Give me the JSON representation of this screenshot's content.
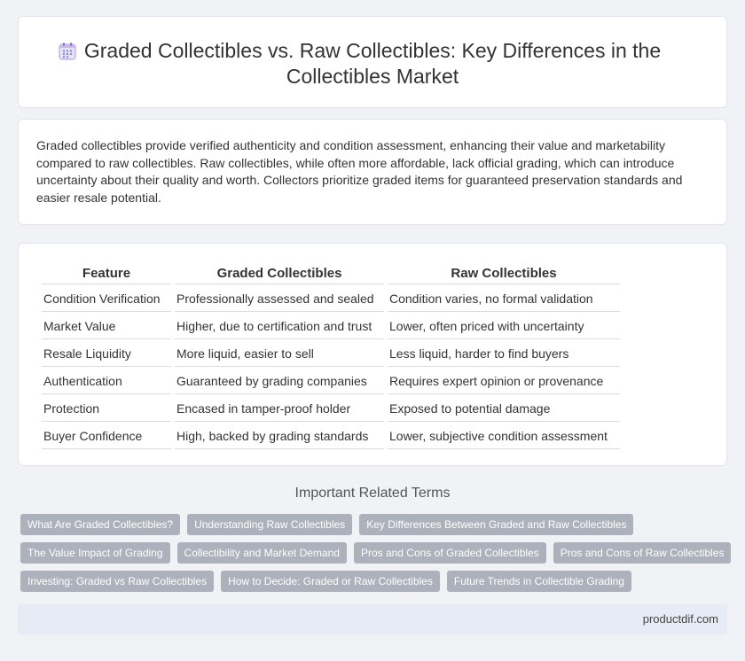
{
  "header": {
    "title": "Graded Collectibles vs. Raw Collectibles: Key Differences in the Collectibles Market",
    "icon": "calendar-grid-icon"
  },
  "intro": {
    "text": "Graded collectibles provide verified authenticity and condition assessment, enhancing their value and marketability compared to raw collectibles. Raw collectibles, while often more affordable, lack official grading, which can introduce uncertainty about their quality and worth. Collectors prioritize graded items for guaranteed preservation standards and easier resale potential."
  },
  "table": {
    "headers": [
      "Feature",
      "Graded Collectibles",
      "Raw Collectibles"
    ],
    "rows": [
      [
        "Condition Verification",
        "Professionally assessed and sealed",
        "Condition varies, no formal validation"
      ],
      [
        "Market Value",
        "Higher, due to certification and trust",
        "Lower, often priced with uncertainty"
      ],
      [
        "Resale Liquidity",
        "More liquid, easier to sell",
        "Less liquid, harder to find buyers"
      ],
      [
        "Authentication",
        "Guaranteed by grading companies",
        "Requires expert opinion or provenance"
      ],
      [
        "Protection",
        "Encased in tamper-proof holder",
        "Exposed to potential damage"
      ],
      [
        "Buyer Confidence",
        "High, backed by grading standards",
        "Lower, subjective condition assessment"
      ]
    ]
  },
  "related": {
    "title": "Important Related Terms",
    "rows": [
      [
        "What Are Graded Collectibles?",
        "Understanding Raw Collectibles",
        "Key Differences Between Graded and Raw Collectibles"
      ],
      [
        "The Value Impact of Grading",
        "Collectibility and Market Demand",
        "Pros and Cons of Graded Collectibles",
        "Pros and Cons of Raw Collectibles"
      ],
      [
        "Investing: Graded vs Raw Collectibles",
        "How to Decide: Graded or Raw Collectibles",
        "Future Trends in Collectible Grading"
      ]
    ]
  },
  "footer": {
    "brand": "productdif.com"
  }
}
